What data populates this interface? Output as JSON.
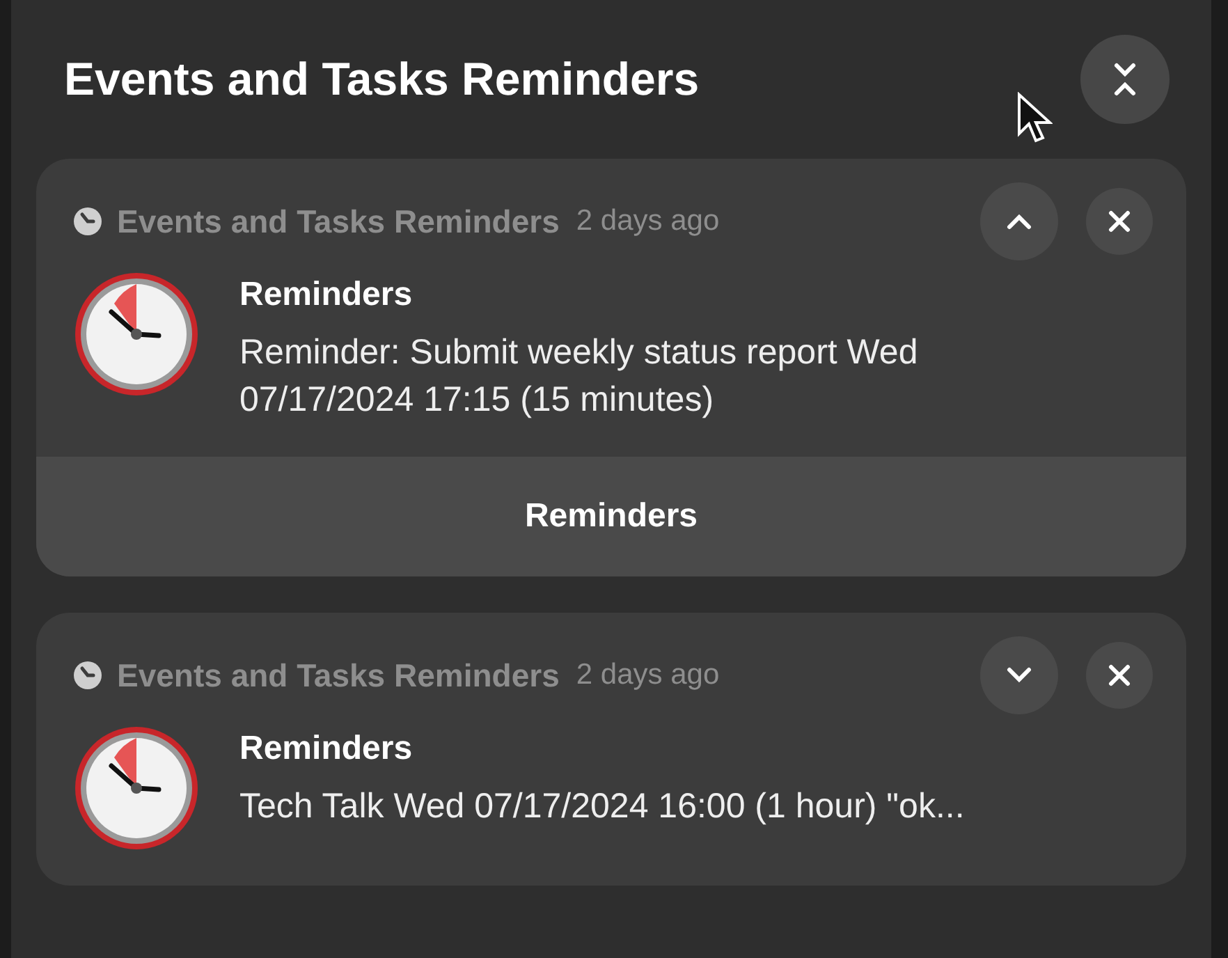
{
  "title": "Events and Tasks Reminders",
  "notifications": [
    {
      "app": "Events and Tasks Reminders",
      "time": "2 days ago",
      "expanded": true,
      "summary": "Reminders",
      "body": "Reminder: Submit weekly status report Wed 07/17/2024 17:15 (15 minutes)",
      "actions": [
        "Reminders"
      ]
    },
    {
      "app": "Events and Tasks Reminders",
      "time": "2 days ago",
      "expanded": false,
      "summary": "Reminders",
      "body": "Tech Talk Wed 07/17/2024 16:00 (1 hour) \"ok..."
    }
  ]
}
